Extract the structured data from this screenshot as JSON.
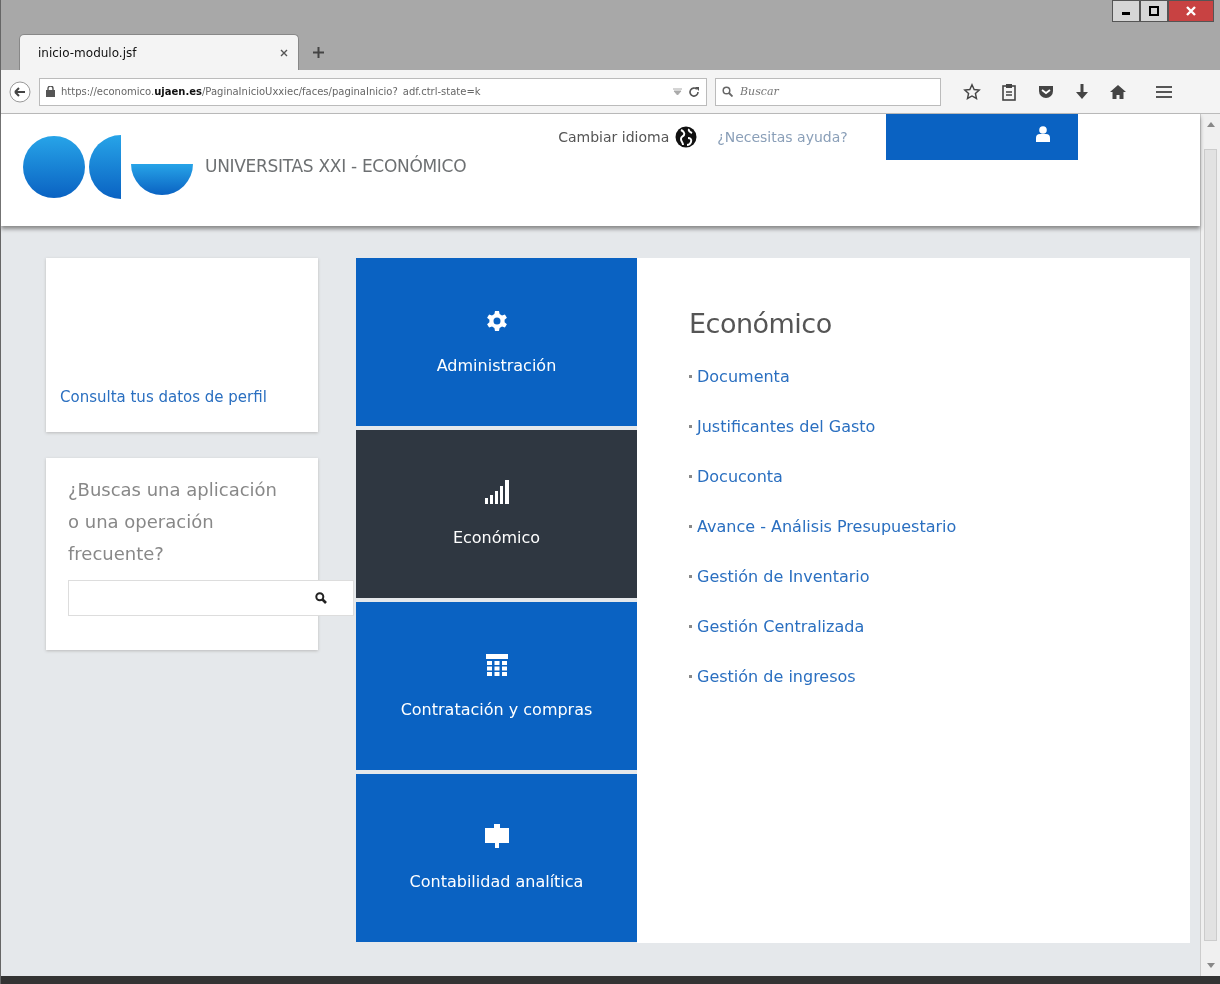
{
  "browser": {
    "tabs": [
      {
        "title": "inicio-modulo.jsf",
        "selected": true
      }
    ],
    "url": "https://economico.**ujaen.es**/PaginaInicioUxxiec/faces/paginaInicio?_adf.ctrl-state=k",
    "search": {
      "placeholder": "Buscar"
    }
  },
  "header": {
    "brand": "UNIVERSITAS XXI - ECONÓMICO",
    "language_link": "Cambiar idioma",
    "help_link": "¿Necesitas ayuda?"
  },
  "profile_card": {
    "link": "Consulta tus datos de perfil"
  },
  "search_card": {
    "prompt": "¿Buscas una aplicación o una operación frecuente?"
  },
  "modules": [
    {
      "label": "Administración",
      "kind": "gear",
      "selected": false
    },
    {
      "label": "Económico",
      "kind": "bars",
      "selected": true
    },
    {
      "label": "Contratación y compras",
      "kind": "table",
      "selected": false
    },
    {
      "label": "Contabilidad analítica",
      "kind": "screen",
      "selected": false
    }
  ],
  "section": {
    "title": "Económico",
    "links": [
      "Documenta",
      "Justificantes del Gasto",
      "Docuconta",
      "Avance - Análisis Presupuestario",
      "Gestión de Inventario",
      "Gestión Centralizada",
      "Gestión de ingresos"
    ]
  }
}
